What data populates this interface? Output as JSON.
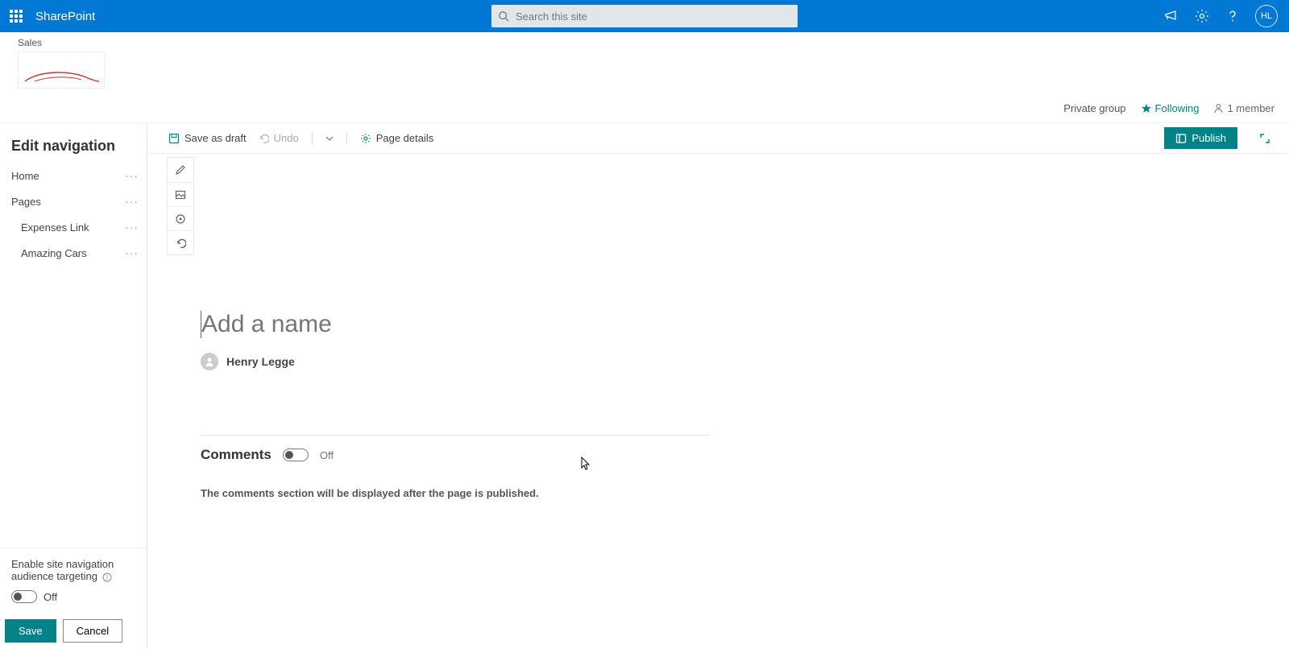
{
  "suite": {
    "app_name": "SharePoint",
    "search_placeholder": "Search this site",
    "avatar_initials": "HL"
  },
  "site": {
    "title": "Sales",
    "privacy": "Private group",
    "following_label": "Following",
    "member_count": "1 member"
  },
  "sidebar": {
    "title": "Edit navigation",
    "items": [
      {
        "label": "Home",
        "sub": false
      },
      {
        "label": "Pages",
        "sub": false
      },
      {
        "label": "Expenses Link",
        "sub": true
      },
      {
        "label": "Amazing Cars",
        "sub": true
      }
    ],
    "audience_targeting_label": "Enable site navigation audience targeting",
    "audience_toggle_state": "Off",
    "save_label": "Save",
    "cancel_label": "Cancel"
  },
  "cmdbar": {
    "save_draft": "Save as draft",
    "undo": "Undo",
    "page_details": "Page details",
    "publish": "Publish"
  },
  "page": {
    "title_placeholder": "Add a name",
    "author": "Henry Legge",
    "comments_heading": "Comments",
    "comments_toggle_state": "Off",
    "comments_note": "The comments section will be displayed after the page is published."
  }
}
